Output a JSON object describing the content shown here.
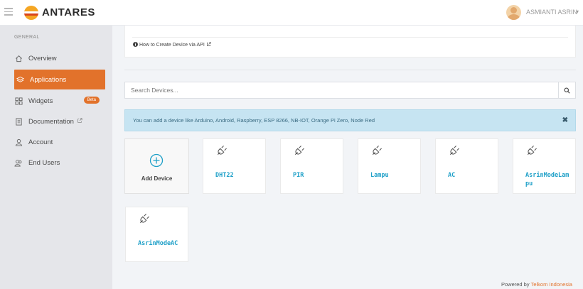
{
  "header": {
    "brand": "ANTARES",
    "user_name": "ASMIANTI ASRIN",
    "caret": "▾"
  },
  "sidebar": {
    "section": "GENERAL",
    "items": [
      {
        "label": "Overview",
        "icon": "home-icon"
      },
      {
        "label": "Applications",
        "icon": "layers-icon",
        "active": true
      },
      {
        "label": "Widgets",
        "icon": "grid-icon",
        "badge": "Beta"
      },
      {
        "label": "Documentation",
        "icon": "book-icon",
        "external": true
      },
      {
        "label": "Account",
        "icon": "user-icon"
      },
      {
        "label": "End Users",
        "icon": "users-icon"
      }
    ]
  },
  "main": {
    "info_link": "How to Create Device via API",
    "search_placeholder": "Search Devices...",
    "alert_text": "You can add a device like Arduino, Android, Raspberry, ESP 8266, NB-IOT, Orange Pi Zero, Node Red",
    "alert_close": "✖",
    "add_device_label": "Add Device",
    "devices": [
      "DHT22",
      "PIR",
      "Lampu",
      "AC",
      "AsrinModeLampu",
      "AsrinModeAC"
    ]
  },
  "footer": {
    "prefix": "Powered by ",
    "link": "Telkom Indonesia"
  },
  "colors": {
    "accent": "#e2722b",
    "device_name": "#1fa0c8",
    "alert_bg": "#c6e4f2"
  }
}
